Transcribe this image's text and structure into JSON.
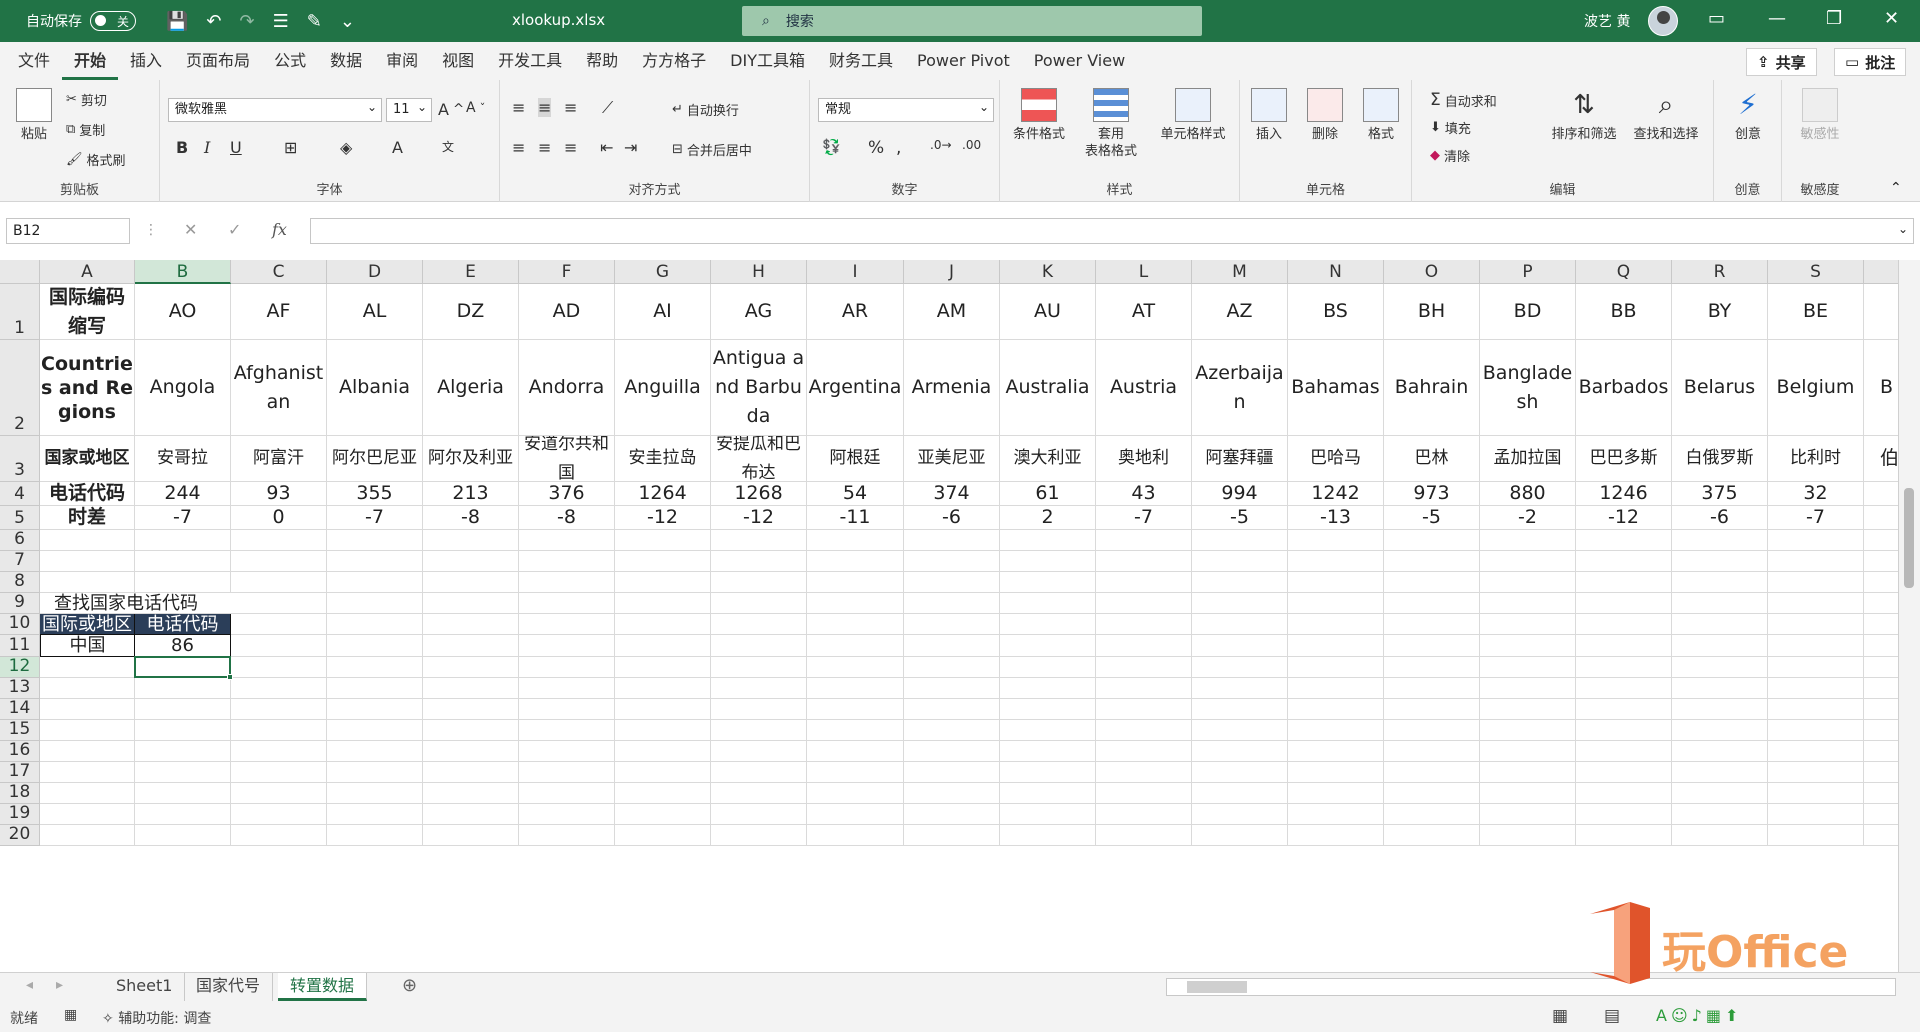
{
  "titlebar": {
    "autosave_label": "自动保存",
    "autosave_state": "关",
    "filename": "xlookup.xlsx",
    "search_placeholder": "搜索",
    "user_name": "波艺 黄"
  },
  "menu": {
    "tabs": [
      "文件",
      "开始",
      "插入",
      "页面布局",
      "公式",
      "数据",
      "审阅",
      "视图",
      "开发工具",
      "帮助",
      "方方格子",
      "DIY工具箱",
      "财务工具",
      "Power Pivot",
      "Power View"
    ],
    "active": "开始",
    "share": "共享",
    "comments": "批注"
  },
  "ribbon": {
    "clipboard": {
      "label": "剪贴板",
      "paste": "粘贴",
      "cut": "剪切",
      "copy": "复制",
      "format_painter": "格式刷"
    },
    "font": {
      "label": "字体",
      "family": "微软雅黑",
      "size": "11"
    },
    "align": {
      "label": "对齐方式",
      "wrap": "自动换行",
      "merge": "合并后居中"
    },
    "number": {
      "label": "数字",
      "format": "常规"
    },
    "styles": {
      "label": "样式",
      "cond": "条件格式",
      "table1": "套用",
      "table2": "表格格式",
      "cellstyle": "单元格样式"
    },
    "cells": {
      "label": "单元格",
      "insert": "插入",
      "delete": "删除",
      "format": "格式"
    },
    "edit": {
      "label": "编辑",
      "autosum": "自动求和",
      "fill": "填充",
      "clear": "清除",
      "sort": "排序和筛选",
      "find": "查找和选择"
    },
    "creative": {
      "label": "创意",
      "btn": "创意"
    },
    "sensitivity": {
      "label": "敏感度",
      "btn": "敏感性"
    }
  },
  "formula_bar": {
    "name_box": "B12",
    "fx": "fx",
    "content": ""
  },
  "grid": {
    "columns": [
      "A",
      "B",
      "C",
      "D",
      "E",
      "F",
      "G",
      "H",
      "I",
      "J",
      "K",
      "L",
      "M",
      "N",
      "O",
      "P",
      "Q",
      "R",
      "S"
    ],
    "selected_col": "B",
    "selected_row": "12",
    "rows": [
      "1",
      "2",
      "3",
      "4",
      "5",
      "6",
      "7",
      "8",
      "9",
      "10",
      "11",
      "12",
      "13",
      "14",
      "15",
      "16",
      "17",
      "18",
      "19",
      "20"
    ],
    "table": {
      "r1": [
        "国际编码缩写",
        "AO",
        "AF",
        "AL",
        "DZ",
        "AD",
        "AI",
        "AG",
        "AR",
        "AM",
        "AU",
        "AT",
        "AZ",
        "BS",
        "BH",
        "BD",
        "BB",
        "BY",
        "BE"
      ],
      "r2": [
        "Countries and Regions",
        "Angola",
        "Afghanistan",
        "Albania",
        "Algeria",
        "Andorra",
        "Anguilla",
        "Antigua and Barbuda",
        "Argentina",
        "Armenia",
        "Australia",
        "Austria",
        "Azerbaijan",
        "Bahamas",
        "Bahrain",
        "Bangladesh",
        "Barbados",
        "Belarus",
        "Belgium"
      ],
      "r3": [
        "国家或地区",
        "安哥拉",
        "阿富汗",
        "阿尔巴尼亚",
        "阿尔及利亚",
        "安道尔共和国",
        "安圭拉岛",
        "安提瓜和巴布达",
        "阿根廷",
        "亚美尼亚",
        "澳大利亚",
        "奥地利",
        "阿塞拜疆",
        "巴哈马",
        "巴林",
        "孟加拉国",
        "巴巴多斯",
        "白俄罗斯",
        "比利时"
      ],
      "r4": [
        "电话代码",
        "244",
        "93",
        "355",
        "213",
        "376",
        "1264",
        "1268",
        "54",
        "374",
        "61",
        "43",
        "994",
        "1242",
        "973",
        "880",
        "1246",
        "375",
        "32"
      ],
      "r5": [
        "时差",
        "-7",
        "0",
        "-7",
        "-8",
        "-8",
        "-12",
        "-12",
        "-11",
        "-6",
        "2",
        "-7",
        "-5",
        "-13",
        "-5",
        "-2",
        "-12",
        "-6",
        "-7"
      ]
    },
    "overflow": {
      "r1": "",
      "r2": "B",
      "r3": "伯"
    },
    "lookup": {
      "title": "查找国家电话代码",
      "h1": "国际或地区",
      "h2": "电话代码",
      "v1": "中国",
      "v2": "86"
    }
  },
  "sheets": {
    "tabs": [
      "Sheet1",
      "国家代号",
      "转置数据"
    ],
    "active": "转置数据"
  },
  "status": {
    "ready": "就绪",
    "accessibility": "辅助功能: 调查"
  },
  "watermark": "玩Office"
}
